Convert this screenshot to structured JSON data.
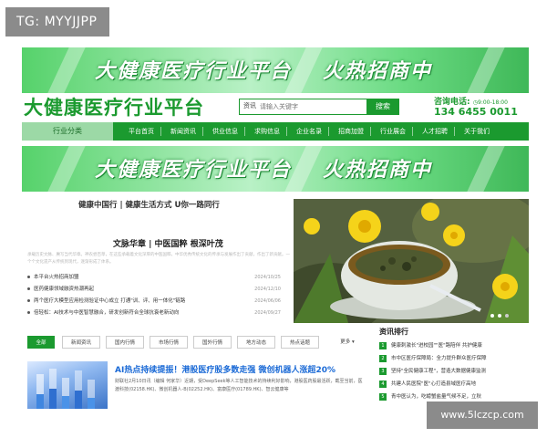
{
  "tag_label": "TG: MYYJJPP",
  "watermark": "www.5lczcp.com",
  "banner": {
    "left_text": "大健康医疗行业平台",
    "right_text": "火热招商中"
  },
  "header": {
    "site_title": "大健康医疗行业平台",
    "search_select": "资讯",
    "search_placeholder": "请输入关键字",
    "search_button": "搜索",
    "consult_label": "咨询电话:",
    "consult_hours": "9:00-18:00",
    "phone": "134 6455 0011"
  },
  "nav": {
    "first": "行业分类",
    "items": [
      "平台首页",
      "新闻资讯",
      "供业信息",
      "求购信息",
      "企业名录",
      "招商加盟",
      "行业展会",
      "人才招聘",
      "关于我们"
    ]
  },
  "slogan": "健康中国行 | 健康生活方式 U你一路同行",
  "feature": {
    "subhead": "文脉华章 | 中医国粹 根深叶茂",
    "para": "承载历史文脉、赓写当代华章。神农尝百草，在这些承载着文化深厚的中医国粹，中华优秀传统文化的传承与发展作出了贡献，作出了新贡献。一个个文化遗产从传统到现代，逐渐形成了体系。",
    "news": [
      {
        "title": "本平台火热招商加盟",
        "date": "2024/10/25"
      },
      {
        "title": "医药健康领域融资热潮再起",
        "date": "2024/12/10"
      },
      {
        "title": "两个医疗大模型应用检测验证中心成立 打通\"训、评、用一体化\"链路",
        "date": "2024/06/06"
      },
      {
        "title": "倍轻松：AI技术与中医智慧融合，研发创新符合全球抗衰老新动向",
        "date": "2024/09/27"
      }
    ]
  },
  "tabs": [
    "全部",
    "新闻资讯",
    "国内行情",
    "市场行情",
    "国外行情",
    "地方动态",
    "热点话题",
    "更多"
  ],
  "ranking": {
    "title": "资讯排行",
    "items": [
      "健康刺激长\"进校园\"\"医\"路陪伴 共护健康",
      "市中区医疗保障局：全力提升群众医疗保障",
      "坚持\"全民健康工程\"，营造大数据健康监测",
      "共建人民医院\"医\"心打造县域医疗高地",
      "青中医认为，吃螃蟹盐量气候不足，立秋"
    ]
  },
  "article": {
    "title": "AI热点持续提振！港股医疗股多数走强 微创机器人涨超20%",
    "body": "财联社2月10日讯（编辑 何家华）近期，受DeepSeek等人工智能技术的持续利好影响，港股医药股最活跃，截至当前，医渡科技(02158.HK)、微创机器人-B(02252.HK)、富康医疗(01789.HK)、智云健康等"
  }
}
